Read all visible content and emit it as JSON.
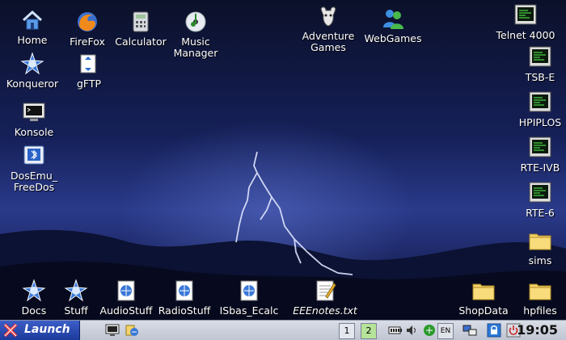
{
  "desktop_icons": {
    "home": "Home",
    "firefox": "FireFox",
    "calculator": "Calculator",
    "music_manager": "Music\nManager",
    "adventure_games": "Adventure\nGames",
    "webgames": "WebGames",
    "telnet": "Telnet 4000",
    "konqueror": "Konqueror",
    "gftp": "gFTP",
    "tsbe": "TSB-E",
    "konsole": "Konsole",
    "hpiplos": "HPIPLOS",
    "dosemu": "DosEmu_\nFreeDos",
    "rteivb": "RTE-IVB",
    "rte6": "RTE-6",
    "sims": "sims",
    "docs": "Docs",
    "stuff": "Stuff",
    "audiostuff": "AudioStuff",
    "radiostuff": "RadioStuff",
    "isbas": "ISbas_Ecalc",
    "eeenotes": "EEEnotes.txt",
    "shopdata": "ShopData",
    "hpfiles": "hpfiles"
  },
  "taskbar": {
    "launch_label": "Launch",
    "desktop_1": "1",
    "desktop_2": "2",
    "clock": "19:05",
    "tray_lang": "EN"
  },
  "colors": {
    "taskbar": "#c9ced9",
    "launch": "#2a4bb3",
    "active_desktop": "#b6e39a"
  }
}
